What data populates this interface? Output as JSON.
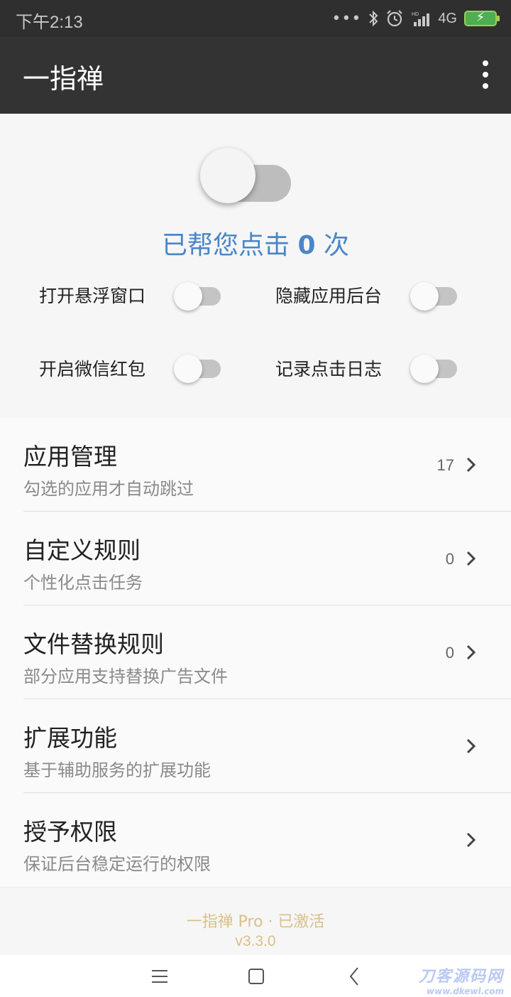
{
  "status_bar": {
    "time": "下午2:13",
    "network": "4G",
    "battery_glyph": "⚡",
    "icons": [
      "more-dots-icon",
      "bluetooth-icon",
      "alarm-icon",
      "hd-signal-icon",
      "network-4g-icon",
      "battery-charging-icon"
    ],
    "dots": "•••"
  },
  "app_bar": {
    "title": "一指禅",
    "menu_icon": "overflow-menu-icon"
  },
  "main_switch": {
    "on": false
  },
  "counter": {
    "prefix": "已帮您点击 ",
    "count": "0",
    "suffix": " 次",
    "color": "#4a86c7"
  },
  "options": [
    {
      "label": "打开悬浮窗口",
      "on": false
    },
    {
      "label": "隐藏应用后台",
      "on": false
    },
    {
      "label": "开启微信红包",
      "on": false
    },
    {
      "label": "记录点击日志",
      "on": false
    }
  ],
  "list": [
    {
      "title": "应用管理",
      "subtitle": "勾选的应用才自动跳过",
      "count": "17"
    },
    {
      "title": "自定义规则",
      "subtitle": "个性化点击任务",
      "count": "0"
    },
    {
      "title": "文件替换规则",
      "subtitle": "部分应用支持替换广告文件",
      "count": "0"
    },
    {
      "title": "扩展功能",
      "subtitle": "基于辅助服务的扩展功能",
      "count": ""
    },
    {
      "title": "授予权限",
      "subtitle": "保证后台稳定运行的权限",
      "count": ""
    }
  ],
  "footer": {
    "pro": "一指禅 Pro · 已激活",
    "version": "v3.3.0",
    "color": "#d9c08a"
  },
  "nav_bar": {
    "buttons": [
      "menu-nav-icon",
      "home-nav-icon",
      "back-nav-icon"
    ]
  },
  "watermark": {
    "line1": "刀客源码网",
    "line2": "www.dkewl.com"
  }
}
